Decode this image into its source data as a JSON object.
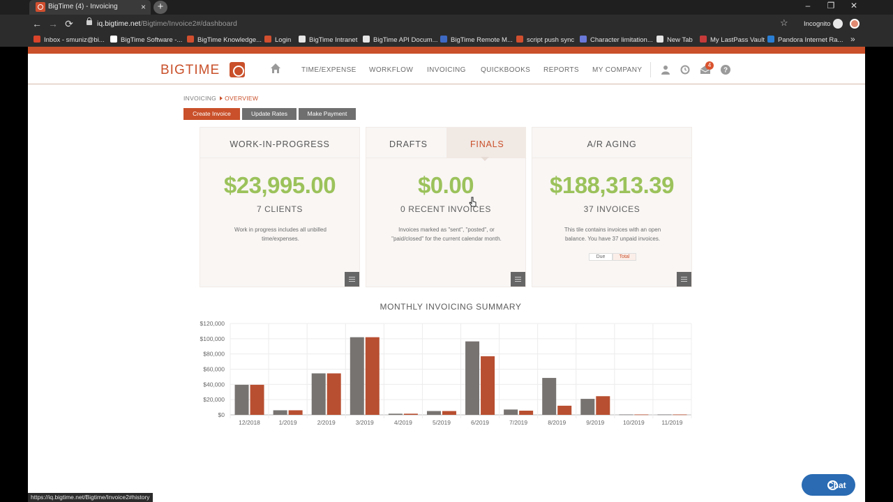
{
  "browser": {
    "tab_title": "BigTime (4) - Invoicing",
    "tab_close": "×",
    "new_tab": "+",
    "url_host": "iq.bigtime.net",
    "url_path": "/Bigtime/Invoice2#/dashboard",
    "incognito_label": "Incognito",
    "status_url": "https://iq.bigtime.net/Bigtime/Invoice2#history",
    "bookmarks": [
      {
        "label": "Inbox - smuniz@bi...",
        "color": "#d9442a"
      },
      {
        "label": "BigTime Software -...",
        "color": "#ffffff"
      },
      {
        "label": "BigTime Knowledge...",
        "color": "#d14f2f"
      },
      {
        "label": "Login",
        "color": "#d14f2f"
      },
      {
        "label": "BigTime Intranet",
        "color": "#e6e6e6"
      },
      {
        "label": "BigTime API Docum...",
        "color": "#e6e6e6"
      },
      {
        "label": "BigTime Remote M...",
        "color": "#3f6ac4"
      },
      {
        "label": "script push sync",
        "color": "#d14f2f"
      },
      {
        "label": "Character limitation...",
        "color": "#6a78d8"
      },
      {
        "label": "New Tab",
        "color": "#e6e6e6"
      },
      {
        "label": "My LastPass Vault",
        "color": "#c63a3a"
      },
      {
        "label": "Pandora Internet Ra...",
        "color": "#2a7fd4"
      }
    ],
    "bookmarks_more": "»"
  },
  "app": {
    "logo": "BIGTIME",
    "nav": [
      "TIME/EXPENSE",
      "WORKFLOW",
      "INVOICING",
      "QUICKBOOKS",
      "REPORTS",
      "MY COMPANY"
    ],
    "notification_count": "4",
    "breadcrumb_root": "INVOICING",
    "breadcrumb_current": "OVERVIEW",
    "buttons": {
      "create": "Create Invoice",
      "update": "Update Rates",
      "payment": "Make Payment"
    },
    "accent_color": "#c9502a",
    "amount_color": "#9bc25b"
  },
  "tiles": {
    "wip": {
      "title": "WORK-IN-PROGRESS",
      "amount": "$23,995.00",
      "sub": "7 CLIENTS",
      "desc": "Work in progress includes all unbilled time/expenses."
    },
    "invoices": {
      "tab_drafts": "DRAFTS",
      "tab_finals": "FINALS",
      "amount": "$0.00",
      "sub": "0 RECENT INVOICES",
      "desc": "Invoices marked as \"sent\", \"posted\", or \"paid/closed\" for the current calendar month."
    },
    "aging": {
      "title": "A/R AGING",
      "amount": "$188,313.39",
      "sub": "37 INVOICES",
      "desc": "This tile contains invoices with an open balance. You have 37 unpaid invoices.",
      "toggle_due": "Due",
      "toggle_total": "Total"
    }
  },
  "chart_data": {
    "type": "bar",
    "title": "MONTHLY INVOICING SUMMARY",
    "categories": [
      "12/2018",
      "1/2019",
      "2/2019",
      "3/2019",
      "4/2019",
      "5/2019",
      "6/2019",
      "7/2019",
      "8/2019",
      "9/2019",
      "10/2019",
      "11/2019"
    ],
    "series": [
      {
        "color": "#777371",
        "values": [
          39500,
          6000,
          54500,
          102000,
          1500,
          5000,
          96500,
          7000,
          48500,
          21000,
          500,
          500
        ]
      },
      {
        "color": "#b84f31",
        "values": [
          39500,
          6000,
          54500,
          102000,
          1500,
          5000,
          77000,
          5500,
          12000,
          24500,
          500,
          500
        ]
      }
    ],
    "ylim": [
      0,
      120000
    ],
    "yticks": [
      "$0",
      "$20,000",
      "$40,000",
      "$60,000",
      "$80,000",
      "$100,000",
      "$120,000"
    ],
    "grid": true,
    "legend": "none"
  },
  "chat": {
    "label": "Chat"
  }
}
